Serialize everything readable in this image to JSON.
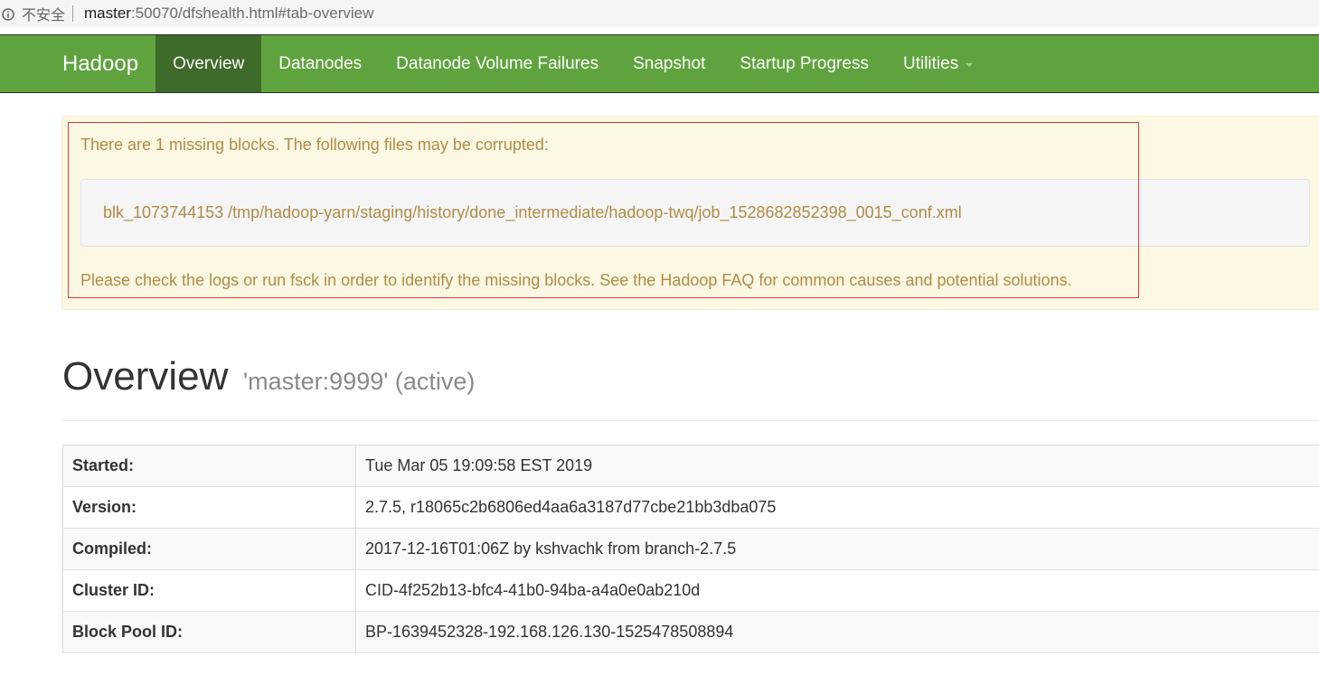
{
  "browser": {
    "security_label": "不安全",
    "url_host": "master",
    "url_rest": ":50070/dfshealth.html#tab-overview"
  },
  "navbar": {
    "brand": "Hadoop",
    "items": [
      {
        "label": "Overview",
        "active": true
      },
      {
        "label": "Datanodes",
        "active": false
      },
      {
        "label": "Datanode Volume Failures",
        "active": false
      },
      {
        "label": "Snapshot",
        "active": false
      },
      {
        "label": "Startup Progress",
        "active": false
      },
      {
        "label": "Utilities",
        "active": false,
        "dropdown": true
      }
    ]
  },
  "alert": {
    "heading": "There are 1 missing blocks. The following files may be corrupted:",
    "block_line": "blk_1073744153 /tmp/hadoop-yarn/staging/history/done_intermediate/hadoop-twq/job_1528682852398_0015_conf.xml",
    "footer": "Please check the logs or run fsck in order to identify the missing blocks. See the Hadoop FAQ for common causes and potential solutions."
  },
  "overview": {
    "title": "Overview",
    "subtitle": "'master:9999' (active)",
    "rows": [
      {
        "key": "Started:",
        "value": "Tue Mar 05 19:09:58 EST 2019"
      },
      {
        "key": "Version:",
        "value": "2.7.5, r18065c2b6806ed4aa6a3187d77cbe21bb3dba075"
      },
      {
        "key": "Compiled:",
        "value": "2017-12-16T01:06Z by kshvachk from branch-2.7.5"
      },
      {
        "key": "Cluster ID:",
        "value": "CID-4f252b13-bfc4-41b0-94ba-a4a0e0ab210d"
      },
      {
        "key": "Block Pool ID:",
        "value": "BP-1639452328-192.168.126.130-1525478508894"
      }
    ]
  },
  "colors": {
    "navbar": "#5fa33e",
    "navbar_active": "#3e6a2a",
    "alert_bg": "#fcf8e3",
    "alert_text": "#b38b45",
    "highlight": "#e23b3b"
  }
}
